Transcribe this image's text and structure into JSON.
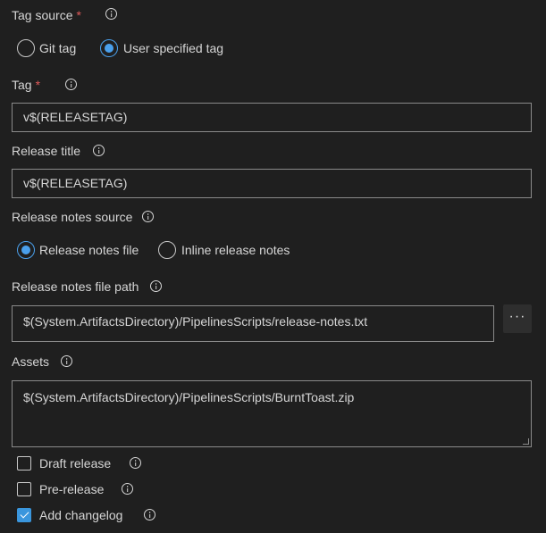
{
  "tag_source": {
    "label": "Tag source",
    "required_mark": "*",
    "options": [
      {
        "label": "Git tag",
        "checked": false
      },
      {
        "label": "User specified tag",
        "checked": true
      }
    ]
  },
  "tag": {
    "label": "Tag",
    "required_mark": "*",
    "value": "v$(RELEASETAG)"
  },
  "release_title": {
    "label": "Release title",
    "value": "v$(RELEASETAG)"
  },
  "release_notes_source": {
    "label": "Release notes source",
    "options": [
      {
        "label": "Release notes file",
        "checked": true
      },
      {
        "label": "Inline release notes",
        "checked": false
      }
    ]
  },
  "release_notes_file_path": {
    "label": "Release notes file path",
    "value": "$(System.ArtifactsDirectory)/PipelinesScripts/release-notes.txt",
    "browse_label": "···"
  },
  "assets": {
    "label": "Assets",
    "value": "$(System.ArtifactsDirectory)/PipelinesScripts/BurntToast.zip"
  },
  "checkboxes": [
    {
      "label": "Draft release",
      "checked": false
    },
    {
      "label": "Pre-release",
      "checked": false
    },
    {
      "label": "Add changelog",
      "checked": true
    }
  ],
  "colors": {
    "background": "#1f1f1f",
    "accent": "#4aa0ec",
    "required": "#e05a5a"
  }
}
